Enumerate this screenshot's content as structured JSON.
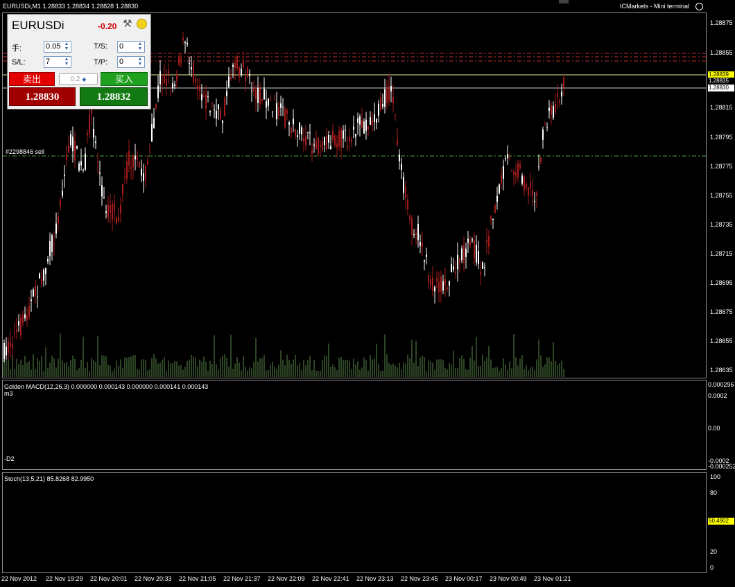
{
  "header": {
    "symbol_info": "EURUSDi,M1  1.28833 1.28834 1.28828 1.28830",
    "broker_label": "ICMarkets - Mini terminal",
    "smile_icon": "smiley-icon"
  },
  "trade_panel": {
    "symbol": "EURUSDi",
    "change": "-0.20",
    "lots_label": "手:",
    "lots_value": "0.05",
    "sl_label": "S/L:",
    "sl_value": "7",
    "ts_label": "T/S:",
    "ts_value": "0",
    "tp_label": "T/P:",
    "tp_value": "0",
    "sell_label": "卖出",
    "buy_label": "买入",
    "spread_value": "0.2",
    "bid": "1.28830",
    "ask": "1.28832",
    "tools_icon": "tools-icon",
    "status_icon": "status-dot-icon"
  },
  "main_chart": {
    "order_label": "#2298846 sell",
    "price_axis": [
      "1.28855",
      "1.28815",
      "1.28795",
      "1.28775",
      "1.28755",
      "1.28735",
      "1.28715",
      "1.28695",
      "1.28675",
      "1.28655",
      "1.28635"
    ],
    "tags": {
      "ask_tag": "1.28839",
      "mid_tag": "1.28835",
      "bid_tag": "1.28830"
    },
    "top_axis_first": "1.28875"
  },
  "macd": {
    "title": "Golden MACD(12,26,3) 0.000000 0.000143 0.000000 0.000141 0.000143",
    "m3_label": "m3",
    "d2_label": "-D2",
    "axis": [
      "0.000296",
      "0.0002",
      "0.00",
      "-0.0002",
      "-0.000252"
    ]
  },
  "stoch": {
    "title": "Stoch(13,5,21) 85.8268 82.9950",
    "axis": [
      "100",
      "80",
      "20",
      "0"
    ],
    "tag": "50.4902"
  },
  "time_axis": [
    "22 Nov 2012",
    "22 Nov 19:29",
    "22 Nov 20:01",
    "22 Nov 20:33",
    "22 Nov 21:05",
    "22 Nov 21:37",
    "22 Nov 22:09",
    "22 Nov 22:41",
    "22 Nov 23:13",
    "22 Nov 23:45",
    "23 Nov 00:17",
    "23 Nov 00:49",
    "23 Nov 01:21"
  ],
  "colors": {
    "bull_candle": "#a61c1c",
    "bear_candle": "#ffffff",
    "volume": "#5a8a4a",
    "macd_line": "#e05050",
    "macd_signal": "#40c040",
    "stoch_main": "#2ab0b0",
    "stoch_signal": "#e03030",
    "order_line": "#4caa4c",
    "level_red": "#c03030",
    "level_yellow": "#e8e8a0"
  }
}
